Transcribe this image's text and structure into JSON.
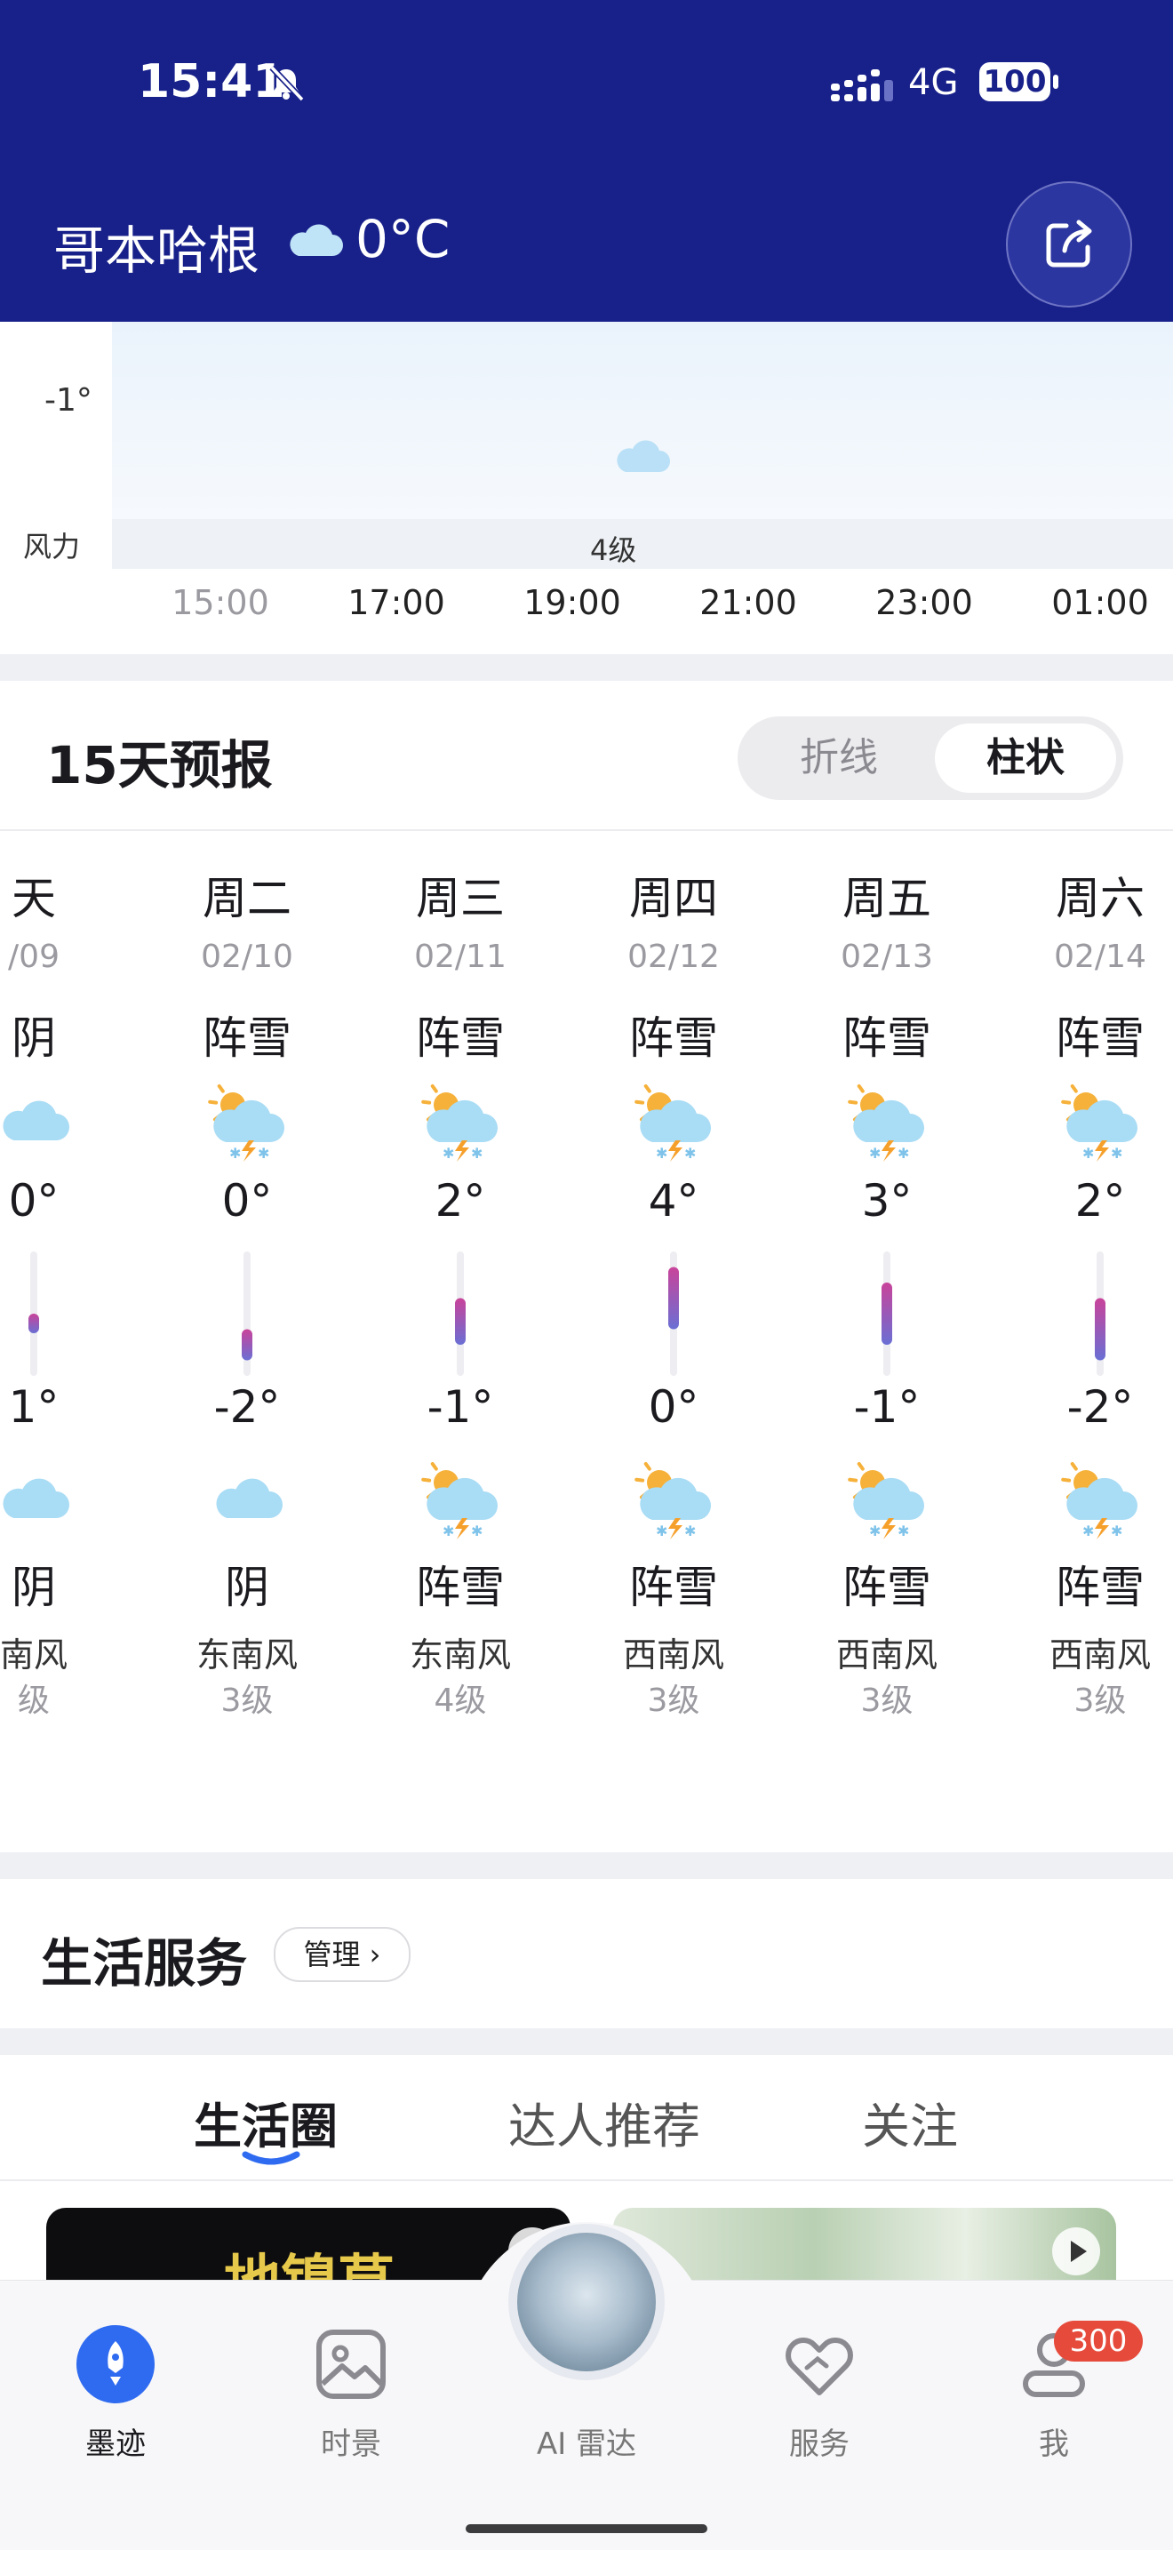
{
  "status_bar": {
    "time": "15:41",
    "network": "4G",
    "battery": "100"
  },
  "header": {
    "city": "哥本哈根",
    "temperature": "0°C"
  },
  "hourly": {
    "temp_axis_label": "-1°",
    "wind_row_label": "风力",
    "wind_value": "4级",
    "times": [
      "15:00",
      "17:00",
      "19:00",
      "21:00",
      "23:00",
      "01:00"
    ]
  },
  "forecast": {
    "title": "15天预报",
    "view_options": [
      "折线",
      "柱状"
    ],
    "selected_view": "柱状",
    "days": [
      {
        "name": "天",
        "date": "/09",
        "day_cond": "阴",
        "high": "0°",
        "low": "1°",
        "night_cond": "阴",
        "wind_dir": "南风",
        "wind_level": "级",
        "day_icon": "cloud-icon",
        "night_icon": "cloud-icon"
      },
      {
        "name": "周二",
        "date": "02/10",
        "day_cond": "阵雪",
        "high": "0°",
        "low": "-2°",
        "night_cond": "阴",
        "wind_dir": "东南风",
        "wind_level": "3级",
        "day_icon": "snow-shower-day-icon",
        "night_icon": "cloud-icon"
      },
      {
        "name": "周三",
        "date": "02/11",
        "day_cond": "阵雪",
        "high": "2°",
        "low": "-1°",
        "night_cond": "阵雪",
        "wind_dir": "东南风",
        "wind_level": "4级",
        "day_icon": "snow-shower-day-icon",
        "night_icon": "snow-shower-day-icon"
      },
      {
        "name": "周四",
        "date": "02/12",
        "day_cond": "阵雪",
        "high": "4°",
        "low": "0°",
        "night_cond": "阵雪",
        "wind_dir": "西南风",
        "wind_level": "3级",
        "day_icon": "snow-shower-day-icon",
        "night_icon": "snow-shower-day-icon"
      },
      {
        "name": "周五",
        "date": "02/13",
        "day_cond": "阵雪",
        "high": "3°",
        "low": "-1°",
        "night_cond": "阵雪",
        "wind_dir": "西南风",
        "wind_level": "3级",
        "day_icon": "snow-shower-day-icon",
        "night_icon": "snow-shower-day-icon"
      },
      {
        "name": "周六",
        "date": "02/14",
        "day_cond": "阵雪",
        "high": "2°",
        "low": "-2°",
        "night_cond": "阵雪",
        "wind_dir": "西南风",
        "wind_level": "3级",
        "day_icon": "snow-shower-day-icon",
        "night_icon": "snow-shower-day-icon"
      }
    ],
    "range_scale": {
      "min": -3,
      "max": 5
    }
  },
  "life_services": {
    "title": "生活服务",
    "manage_label": "管理 ›"
  },
  "content_tabs": {
    "tabs": [
      "生活圈",
      "达人推荐",
      "关注"
    ],
    "active": "生活圈",
    "card_text": "地镍草"
  },
  "bottom_nav": {
    "items": [
      "墨迹",
      "时景",
      "AI 雷达",
      "服务",
      "我"
    ],
    "active": "墨迹",
    "badge": "300"
  },
  "colors": {
    "header_bg": "#18218a",
    "accent": "#2f6bf0",
    "badge": "#e64a3b"
  }
}
